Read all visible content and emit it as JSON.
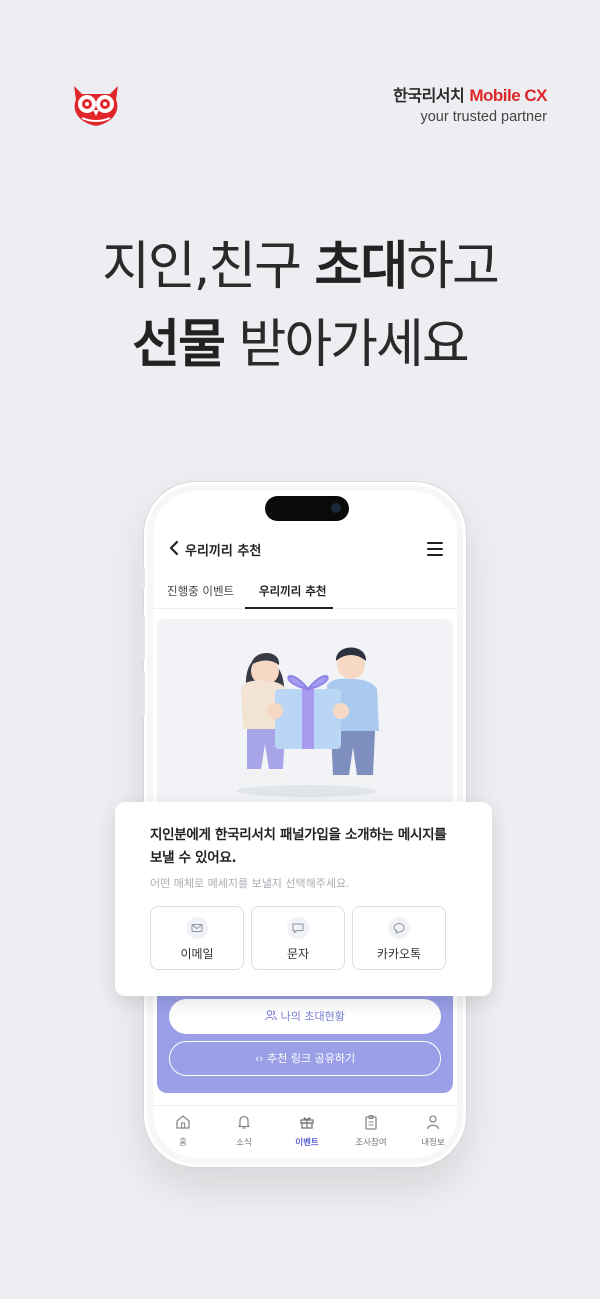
{
  "brand": {
    "name": "한국리서치",
    "name_accent": "Mobile CX",
    "tagline": "your trusted partner",
    "accent_color": "#e0262b"
  },
  "headline": {
    "line1_light": "지인,친구 ",
    "line1_bold": "초대",
    "line1_tail": "하고",
    "line2_bold": "선물",
    "line2_tail": " 받아가세요"
  },
  "appbar": {
    "back_icon": "chevron-left-icon",
    "title": "우리끼리 추천",
    "menu_icon": "hamburger-menu-icon"
  },
  "tabs": [
    {
      "label": "진행중 이벤트",
      "active": false
    },
    {
      "label": "우리끼리 추천",
      "active": true
    }
  ],
  "message_card": {
    "title": "지인분에게 한국리서치 패널가입을 소개하는 메시지를 보낼 수 있어요.",
    "subtitle": "어떤 매체로 메세지를 보낼지 선택해주세요.",
    "options": [
      {
        "label": "이메일",
        "icon": "mail-icon"
      },
      {
        "label": "문자",
        "icon": "message-icon"
      },
      {
        "label": "카카오톡",
        "icon": "chat-bubble-icon"
      }
    ]
  },
  "actions": {
    "invite_status": "나의 초대현황",
    "share_link": "추천 링크 공유하기",
    "panel_color": "#9a9fe8"
  },
  "bottom_nav": [
    {
      "label": "홈",
      "icon": "home-icon",
      "active": false
    },
    {
      "label": "소식",
      "icon": "bell-icon",
      "active": false
    },
    {
      "label": "이벤트",
      "icon": "gift-icon",
      "active": true
    },
    {
      "label": "조사참여",
      "icon": "clipboard-icon",
      "active": false
    },
    {
      "label": "내정보",
      "icon": "user-icon",
      "active": false
    }
  ]
}
